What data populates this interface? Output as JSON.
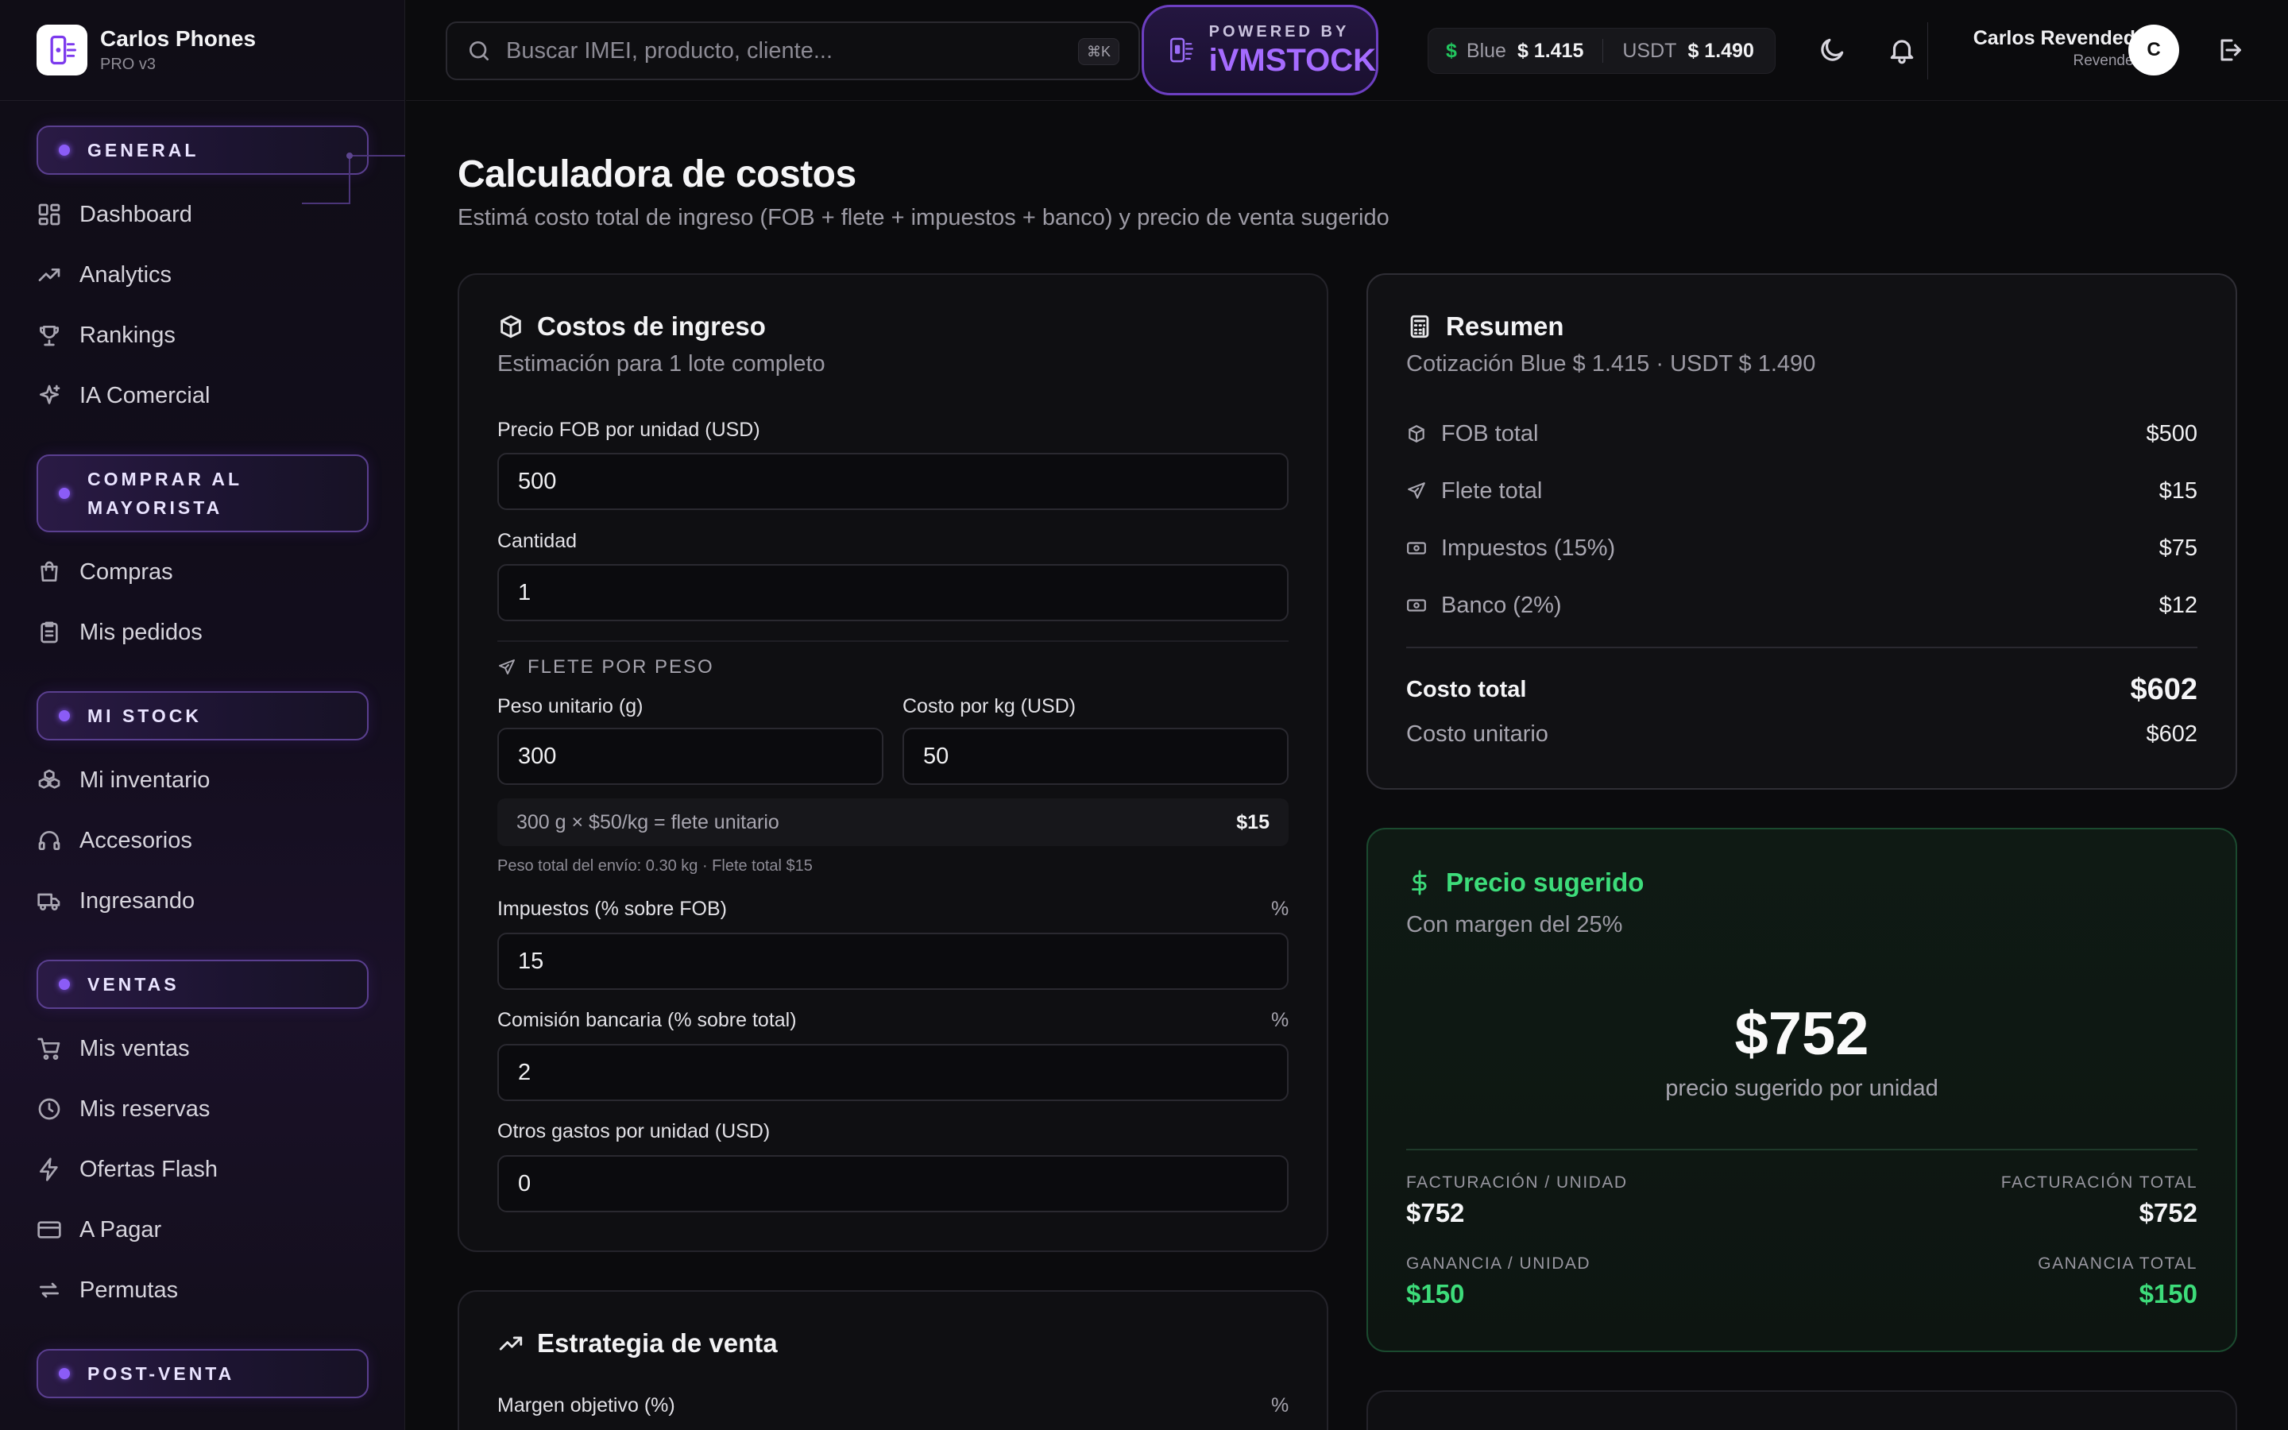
{
  "brand": {
    "name": "Carlos Phones",
    "plan": "PRO v3"
  },
  "sidebar": {
    "sections": [
      {
        "label": "GENERAL",
        "items": [
          "Dashboard",
          "Analytics",
          "Rankings",
          "IA Comercial"
        ]
      },
      {
        "label_line1": "COMPRAR AL",
        "label_line2": "MAYORISTA",
        "items": [
          "Compras",
          "Mis pedidos"
        ]
      },
      {
        "label": "MI STOCK",
        "items": [
          "Mi inventario",
          "Accesorios",
          "Ingresando"
        ]
      },
      {
        "label": "VENTAS",
        "items": [
          "Mis ventas",
          "Mis reservas",
          "Ofertas Flash",
          "A Pagar",
          "Permutas"
        ]
      },
      {
        "label": "POST-VENTA",
        "items": []
      }
    ]
  },
  "topbar": {
    "search_placeholder": "Buscar IMEI, producto, cliente...",
    "search_shortcut": "⌘K",
    "powered_by": "POWERED BY",
    "powered_brand": "iVMSTOCK",
    "rates": {
      "currency_symbol": "$",
      "blue_label": "Blue",
      "blue_value": "$ 1.415",
      "usdt_label": "USDT",
      "usdt_value": "$ 1.490"
    },
    "user": {
      "name": "Carlos Revendedor",
      "role": "Revendedor",
      "initial": "C"
    }
  },
  "page": {
    "title": "Calculadora de costos",
    "subtitle": "Estimá costo total de ingreso (FOB + flete + impuestos + banco) y precio de venta sugerido"
  },
  "costs_card": {
    "title": "Costos de ingreso",
    "subtitle": "Estimación para 1 lote completo",
    "fob_label": "Precio FOB por unidad (USD)",
    "fob_value": "500",
    "qty_label": "Cantidad",
    "qty_value": "1",
    "freight_header": "FLETE POR PESO",
    "weight_label": "Peso unitario (g)",
    "weight_value": "300",
    "cost_kg_label": "Costo por kg (USD)",
    "cost_kg_value": "50",
    "formula_text": "300 g × $50/kg = flete unitario",
    "formula_value": "$15",
    "weight_note": "Peso total del envío: 0.30 kg · Flete total $15",
    "tax_label": "Impuestos (% sobre FOB)",
    "tax_unit": "%",
    "tax_value": "15",
    "bank_label": "Comisión bancaria (% sobre total)",
    "bank_unit": "%",
    "bank_value": "2",
    "other_label": "Otros gastos por unidad (USD)",
    "other_value": "0"
  },
  "strategy_card": {
    "title": "Estrategia de venta",
    "margin_label": "Margen objetivo (%)",
    "margin_unit": "%"
  },
  "summary": {
    "title": "Resumen",
    "subtitle": "Cotización Blue $ 1.415 · USDT $ 1.490",
    "rows": [
      {
        "label": "FOB total",
        "value": "$500",
        "icon": "box-icon"
      },
      {
        "label": "Flete total",
        "value": "$15",
        "icon": "plane-icon"
      },
      {
        "label": "Impuestos (15%)",
        "value": "$75",
        "icon": "banknote-icon"
      },
      {
        "label": "Banco (2%)",
        "value": "$12",
        "icon": "banknote-icon"
      }
    ],
    "total_label": "Costo total",
    "total_value": "$602",
    "unit_label": "Costo unitario",
    "unit_value": "$602"
  },
  "suggested": {
    "title": "Precio sugerido",
    "subtitle": "Con margen del 25%",
    "price": "$752",
    "price_caption": "precio sugerido por unidad",
    "billing_unit_label": "FACTURACIÓN / UNIDAD",
    "billing_unit_value": "$752",
    "billing_total_label": "FACTURACIÓN TOTAL",
    "billing_total_value": "$752",
    "profit_unit_label": "GANANCIA / UNIDAD",
    "profit_unit_value": "$150",
    "profit_total_label": "GANANCIA TOTAL",
    "profit_total_value": "$150"
  },
  "colors": {
    "accent": "#8b5cf6",
    "success": "#3ddc7a",
    "background": "#0b0b0d"
  }
}
